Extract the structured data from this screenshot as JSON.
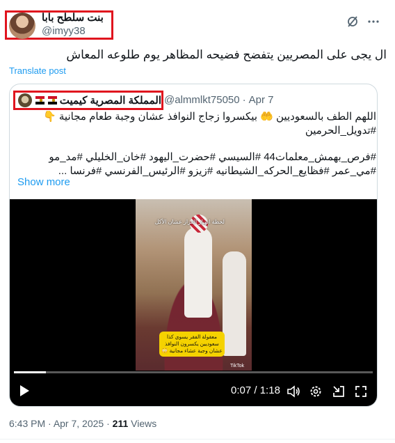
{
  "tweet": {
    "display_name": "بنت سلطح بابا",
    "handle": "@imyy38",
    "text": "ال يجى على المصريين يتفضح فضيحه المظاهر يوم طلوعه المعاش",
    "translate_label": "Translate post",
    "more_icon": "ellipsis-icon",
    "grok_icon": "grok-slash-icon"
  },
  "quote": {
    "display_name": "المملكة المصرية كيميت",
    "handle": "@almmlkt75050",
    "separator": "·",
    "date": "Apr 7",
    "lines": [
      "اللهم الطف بالسعوديين 🤲 بيكسروا زجاج النوافذ عشان وجبة طعام مجانية 👇",
      "#تدويل_الحرمين",
      "",
      "#فرص_بهمش_معلمات44 #السيسي #حضرت_اليهود #خان_الخليلي #مد_مو",
      "#مي_عمر #فظايع_الحركه_الشيطانيه #زيزو #الرئيس_الفرنسي #فرنسا ..."
    ],
    "show_more": "Show more"
  },
  "video": {
    "overlay_top": "لحظة انهيار القزاز عشان الأكل",
    "caption_lines": [
      "معقولة الفقر يسوي كذا",
      "سعوديين يكسرون النوافذ",
      "عشان وجبة عشاء مجانية 😳"
    ],
    "watermark": "TikTok",
    "current_time": "0:07",
    "duration": "1:18",
    "time_sep": " / ",
    "progress": 0.09
  },
  "footer": {
    "time": "6:43 PM",
    "dot": " · ",
    "date": "Apr 7, 2025",
    "views_count": "211",
    "views_label": "Views"
  }
}
